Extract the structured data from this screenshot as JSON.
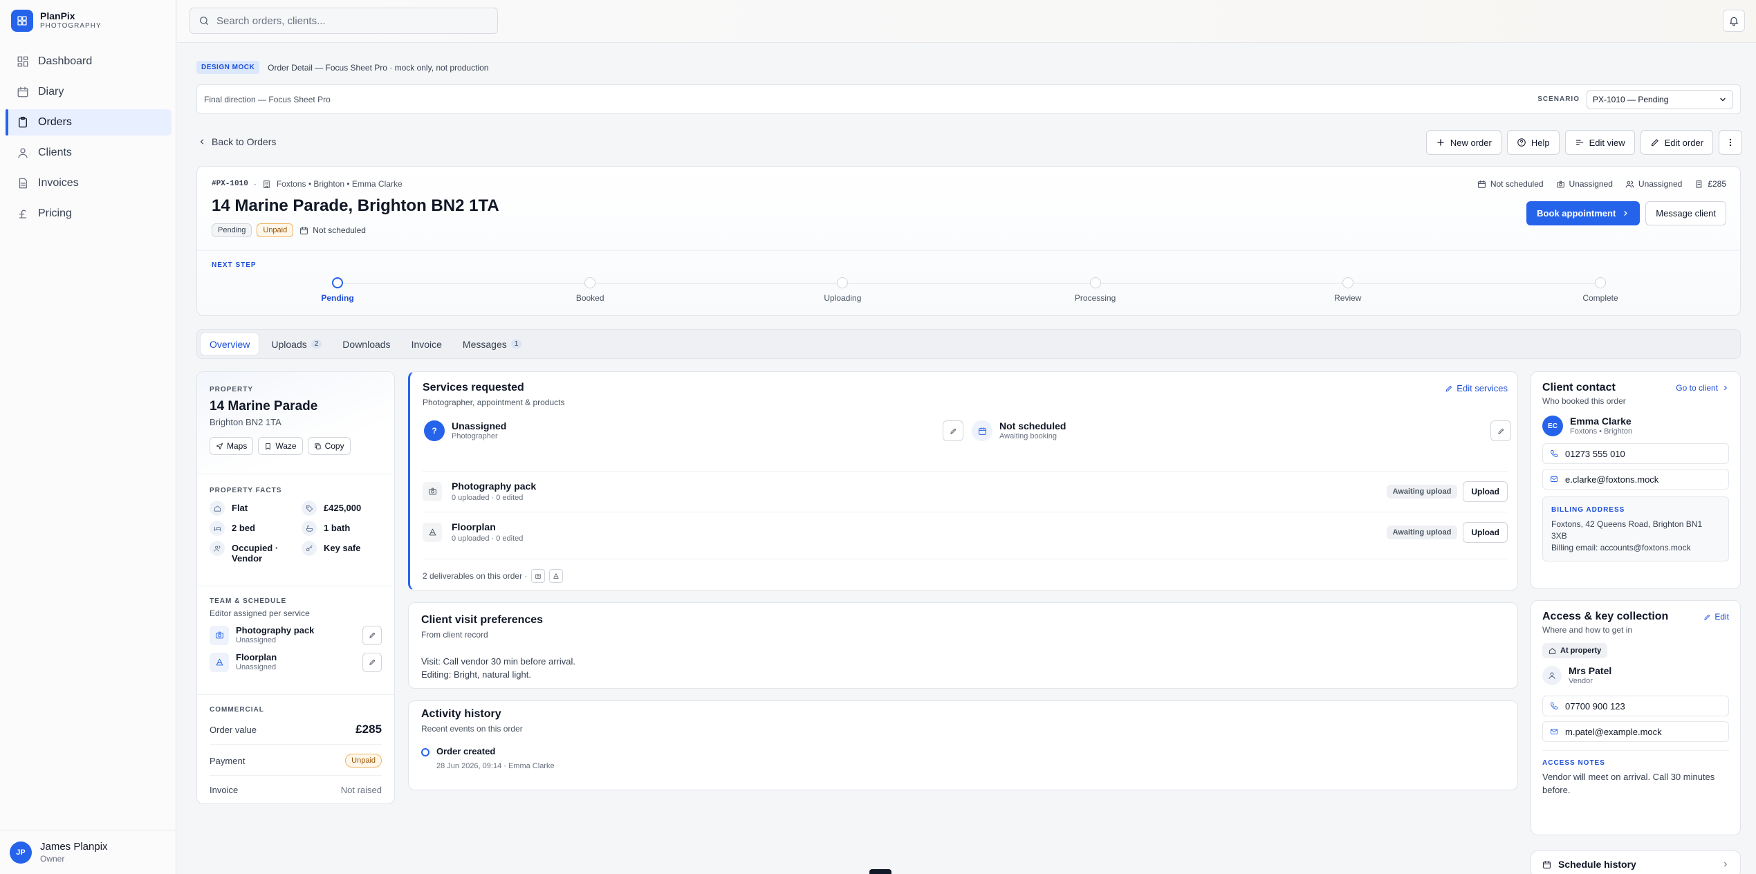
{
  "brand": {
    "name": "PlanPix",
    "sub": "PHOTOGRAPHY"
  },
  "nav": [
    {
      "label": "Dashboard",
      "icon": "grid-icon"
    },
    {
      "label": "Diary",
      "icon": "calendar-icon"
    },
    {
      "label": "Orders",
      "icon": "clipboard-icon",
      "active": true
    },
    {
      "label": "Clients",
      "icon": "user-icon"
    },
    {
      "label": "Invoices",
      "icon": "file-icon"
    },
    {
      "label": "Pricing",
      "icon": "pound-icon"
    }
  ],
  "user": {
    "initials": "JP",
    "name": "James Planpix",
    "role": "Owner"
  },
  "search": {
    "placeholder": "Search orders, clients..."
  },
  "mock": {
    "badge": "DESIGN MOCK",
    "text": "Order Detail — Focus Sheet Pro · mock only, not production"
  },
  "scenario": {
    "left": "Final direction — Focus Sheet Pro",
    "label": "SCENARIO",
    "value": "PX-1010 — Pending"
  },
  "back_label": "Back to Orders",
  "actions": {
    "new_order": "New order",
    "help": "Help",
    "edit_view": "Edit view",
    "edit_order": "Edit order"
  },
  "order": {
    "id": "#PX-1010",
    "meta": "Foxtons • Brighton • Emma Clarke",
    "title": "14 Marine Parade, Brighton BN2 1TA",
    "status": "Pending",
    "payment": "Unpaid",
    "schedule": "Not scheduled",
    "stats": {
      "schedule": "Not scheduled",
      "photographer": "Unassigned",
      "editor": "Unassigned",
      "value": "£285"
    },
    "book_label": "Book appointment",
    "message_label": "Message client",
    "next_step_label": "NEXT STEP",
    "steps": [
      "Pending",
      "Booked",
      "Uploading",
      "Processing",
      "Review",
      "Complete"
    ],
    "current_step": 0
  },
  "tabs": [
    {
      "label": "Overview",
      "active": true
    },
    {
      "label": "Uploads",
      "count": "2"
    },
    {
      "label": "Downloads"
    },
    {
      "label": "Invoice"
    },
    {
      "label": "Messages",
      "count": "1"
    }
  ],
  "property": {
    "label": "PROPERTY",
    "name": "14 Marine Parade",
    "postcode": "Brighton BN2 1TA",
    "buttons": {
      "maps": "Maps",
      "waze": "Waze",
      "copy": "Copy"
    },
    "facts_label": "PROPERTY FACTS",
    "facts": {
      "type": "Flat",
      "price": "£425,000",
      "beds": "2 bed",
      "baths": "1 bath",
      "occupancy": "Occupied · Vendor",
      "access": "Key safe"
    },
    "team_label": "TEAM & SCHEDULE",
    "team_sub": "Editor assigned per service",
    "team": [
      {
        "name": "Photography pack",
        "status": "Unassigned"
      },
      {
        "name": "Floorplan",
        "status": "Unassigned"
      }
    ],
    "commercial_label": "COMMERCIAL",
    "commercial": {
      "value_label": "Order value",
      "value": "£285",
      "payment_label": "Payment",
      "payment": "Unpaid",
      "invoice_label": "Invoice",
      "invoice": "Not raised"
    }
  },
  "services": {
    "title": "Services requested",
    "sub": "Photographer, appointment & products",
    "edit_label": "Edit services",
    "photographer": {
      "name": "Unassigned",
      "role": "Photographer"
    },
    "appointment": {
      "name": "Not scheduled",
      "sub": "Awaiting booking"
    },
    "deliverables": [
      {
        "name": "Photography pack",
        "progress": "0 uploaded · 0 edited",
        "status": "Awaiting upload",
        "action": "Upload"
      },
      {
        "name": "Floorplan",
        "progress": "0 uploaded · 0 edited",
        "status": "Awaiting upload",
        "action": "Upload"
      }
    ],
    "footer": "2 deliverables on this order ·"
  },
  "prefs": {
    "title": "Client visit preferences",
    "sub": "From client record",
    "visit": "Visit: Call vendor 30 min before arrival.",
    "editing": "Editing: Bright, natural light."
  },
  "activity": {
    "title": "Activity history",
    "sub": "Recent events on this order",
    "events": [
      {
        "label": "Order created",
        "meta": "28 Jun 2026, 09:14 · Emma Clarke"
      }
    ]
  },
  "contact": {
    "title": "Client contact",
    "sub": "Who booked this order",
    "go_label": "Go to client",
    "initials": "EC",
    "name": "Emma Clarke",
    "org": "Foxtons • Brighton",
    "phone": "01273 555 010",
    "email": "e.clarke@foxtons.mock",
    "billing_label": "BILLING ADDRESS",
    "billing_address": "Foxtons, 42 Queens Road, Brighton BN1 3XB",
    "billing_email": "Billing email: accounts@foxtons.mock"
  },
  "access": {
    "title": "Access & key collection",
    "sub": "Where and how to get in",
    "edit_label": "Edit",
    "where": "At property",
    "person": "Mrs Patel",
    "role": "Vendor",
    "phone": "07700 900 123",
    "email": "m.patel@example.mock",
    "notes_label": "ACCESS NOTES",
    "notes": "Vendor will meet on arrival. Call 30 minutes before."
  },
  "schedule_history": "Schedule history",
  "colors": {
    "accent": "#2563eb",
    "unpaid": "#f0b260",
    "active_nav": "#e8efff"
  }
}
